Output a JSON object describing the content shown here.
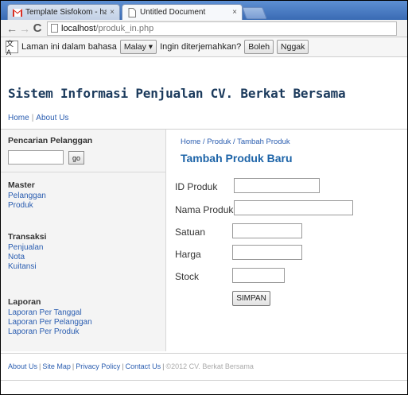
{
  "browser": {
    "tabs": [
      {
        "title": "Template Sisfokom - hamide",
        "icon": "gmail-icon",
        "close": "×"
      },
      {
        "title": "Untitled Document",
        "icon": "page-icon",
        "close": "×"
      }
    ],
    "nav": {
      "back": "←",
      "forward": "→",
      "reload": "C"
    },
    "url_host": "localhost",
    "url_path": "/produk_in.php"
  },
  "translate_bar": {
    "message_prefix": "Laman ini dalam bahasa",
    "language": "Malay ▾",
    "question": "Ingin diterjemahkan?",
    "yes": "Boleh",
    "no": "Nggak"
  },
  "site": {
    "title": "Sistem Informasi Penjualan CV. Berkat Bersama",
    "nav": [
      "Home",
      "About Us"
    ]
  },
  "sidebar": {
    "search_heading": "Pencarian Pelanggan",
    "search_button": "go",
    "master_heading": "Master",
    "master_links": [
      "Pelanggan",
      "Produk"
    ],
    "transaksi_heading": "Transaksi",
    "transaksi_links": [
      "Penjualan",
      "Nota",
      "Kuitansi"
    ],
    "laporan_heading": "Laporan",
    "laporan_links": [
      "Laporan Per Tanggal",
      "Laporan Per Pelanggan",
      "Laporan Per Produk"
    ]
  },
  "main": {
    "breadcrumb": "Home / Produk / Tambah Produk",
    "title": "Tambah Produk Baru",
    "fields": [
      {
        "label": "ID Produk",
        "value": ""
      },
      {
        "label": "Nama Produk",
        "value": ""
      },
      {
        "label": "Satuan",
        "value": ""
      },
      {
        "label": "Harga",
        "value": ""
      },
      {
        "label": "Stock",
        "value": ""
      }
    ],
    "submit": "SIMPAN"
  },
  "footer": {
    "links": [
      "About Us",
      "Site Map",
      "Privacy Policy",
      "Contact Us"
    ],
    "copyright": "©2012 CV. Berkat Bersama"
  }
}
